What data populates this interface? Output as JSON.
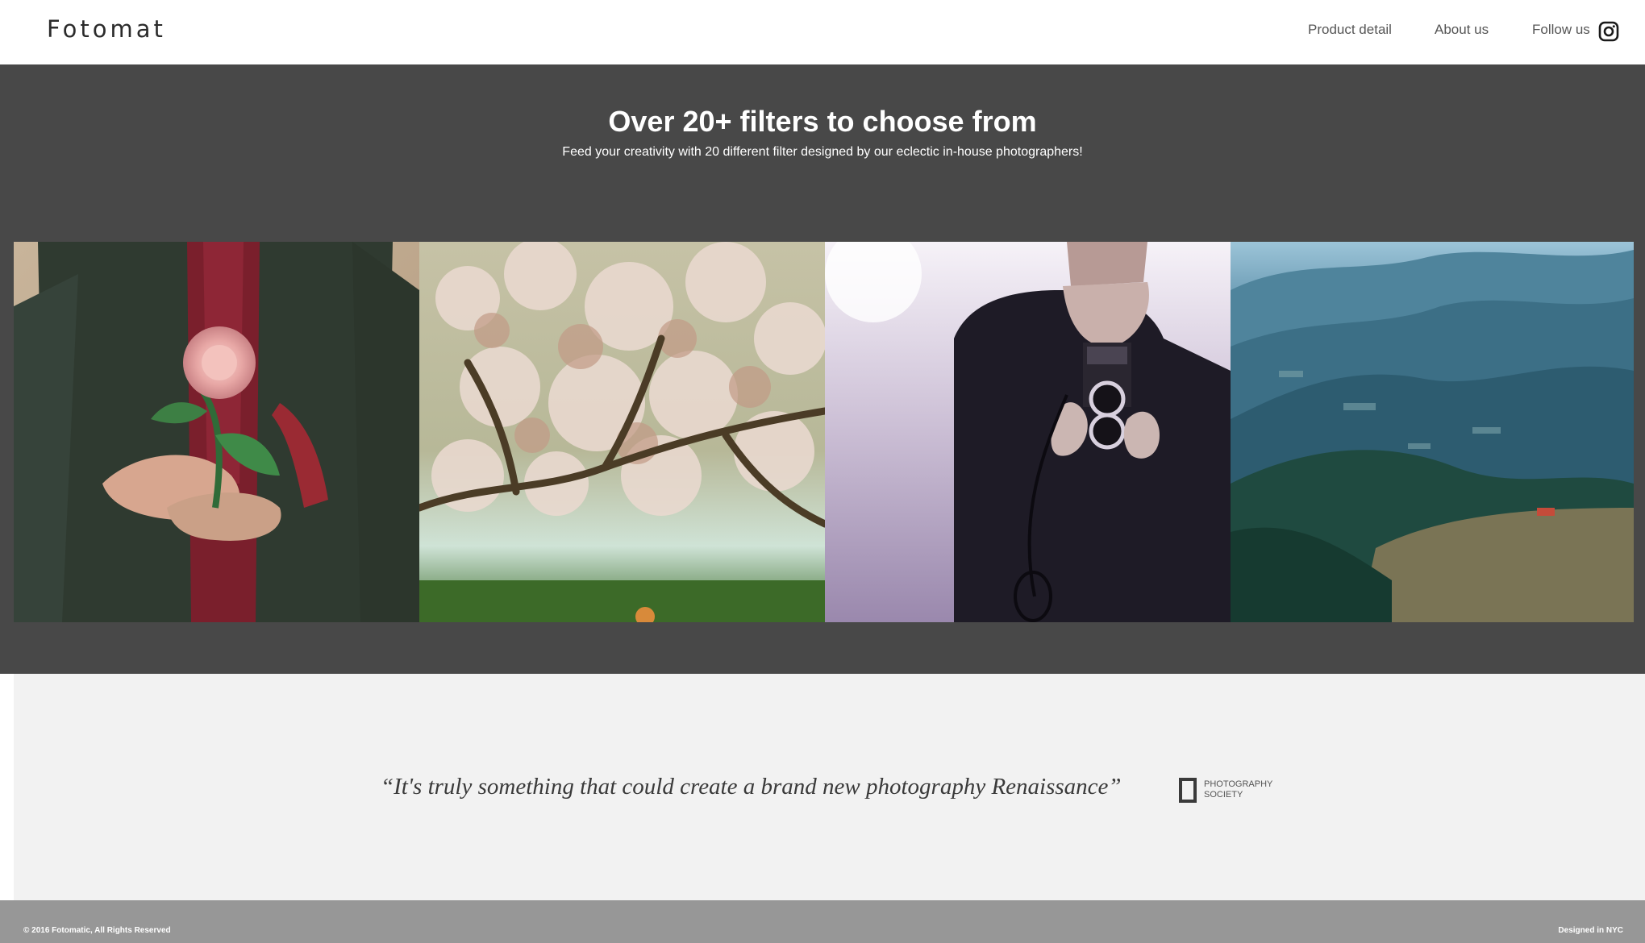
{
  "header": {
    "logo": "Fotomat",
    "nav": {
      "product": "Product detail",
      "about": "About us",
      "follow": "Follow us"
    },
    "social_icon": "instagram-icon"
  },
  "filters": {
    "title": "Over 20+ filters to choose from",
    "subtitle": "Feed your creativity with 20 different filter designed by our eclectic in-house photographers!",
    "photos": [
      "person-holding-rose",
      "blossoming-tree",
      "man-with-twin-lens-camera",
      "mountain-valley-landscape"
    ]
  },
  "testimonial": {
    "quote": "“It's truly something that could create a brand new photography Renaissance”",
    "source": "PHOTOGRAPHY SOCIETY"
  },
  "footer": {
    "copyright": "© 2016 Fotomatic, All Rights Reserved",
    "designed": "Designed in NYC"
  },
  "colors": {
    "filters_bg": "#484848",
    "testimonial_bg": "#f2f2f2",
    "footer_bg": "#979797"
  }
}
